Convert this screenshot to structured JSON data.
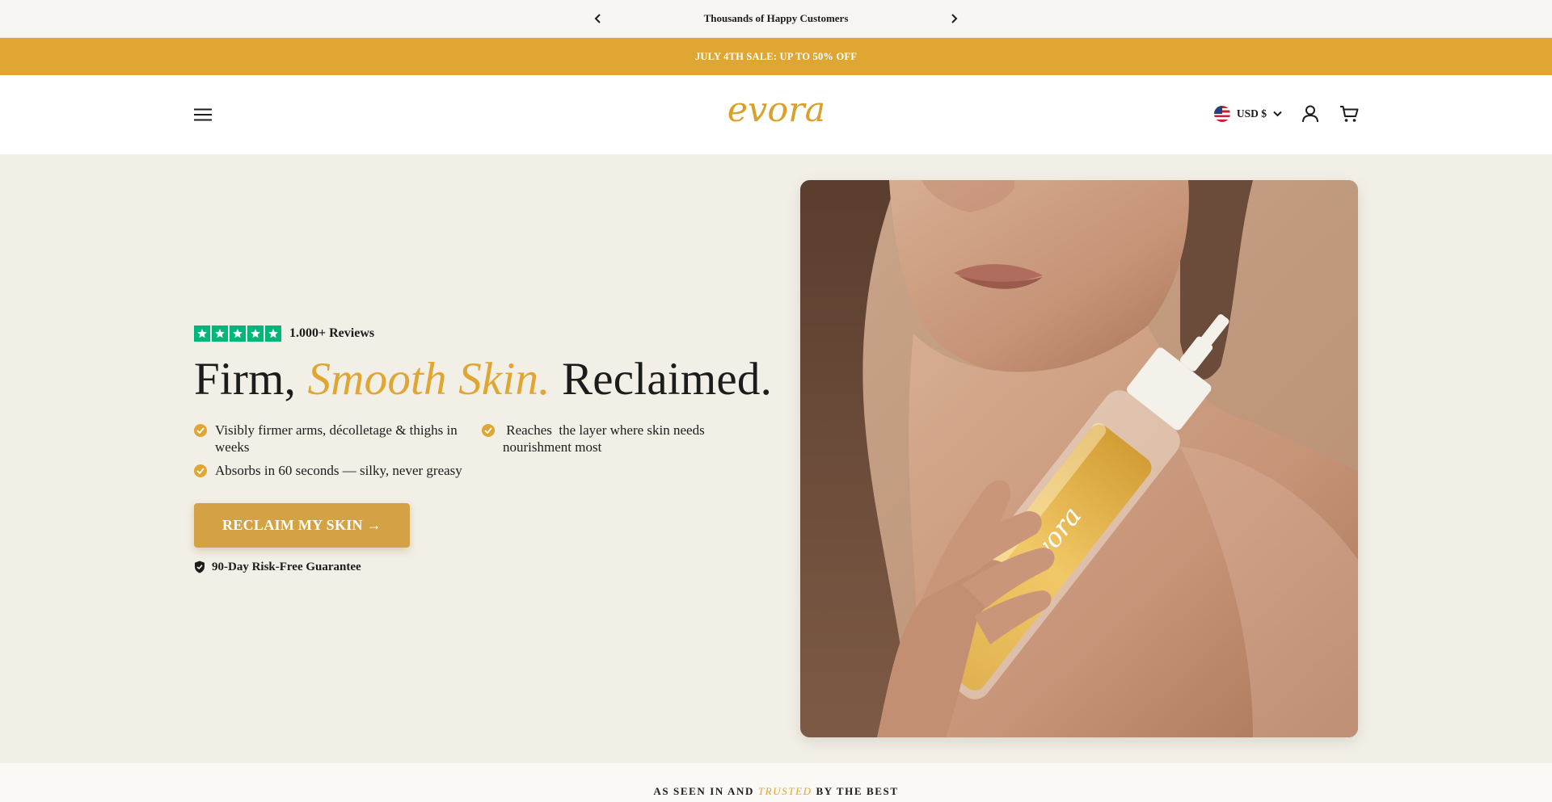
{
  "announcement": {
    "text": "Thousands of Happy Customers"
  },
  "sale_banner": {
    "text": "JULY 4TH SALE: UP TO 50% OFF"
  },
  "header": {
    "logo": "evora",
    "currency": "USD $"
  },
  "hero": {
    "rating": {
      "stars": 5,
      "reviews": "1.000+ Reviews"
    },
    "headline": {
      "part1": "Firm,",
      "accent": "Smooth Skin.",
      "part2": "Reclaimed."
    },
    "benefits": [
      "Visibly firmer arms, décolletage & thighs in weeks",
      " Reaches  the layer where skin needs nourishment most",
      "Absorbs in 60 seconds — silky, never greasy"
    ],
    "cta": "RECLAIM MY SKIN  →",
    "guarantee": "90-Day Risk-Free Guarantee",
    "bottle_label": "evora"
  },
  "press": {
    "title_part1": "AS SEEN IN AND",
    "title_accent": "TRUSTED",
    "title_part2": "BY THE BEST"
  },
  "colors": {
    "accent": "#dfa633",
    "cta": "#d4a245",
    "hero_bg": "#f2efe6",
    "trustpilot_green": "#00b67a"
  }
}
